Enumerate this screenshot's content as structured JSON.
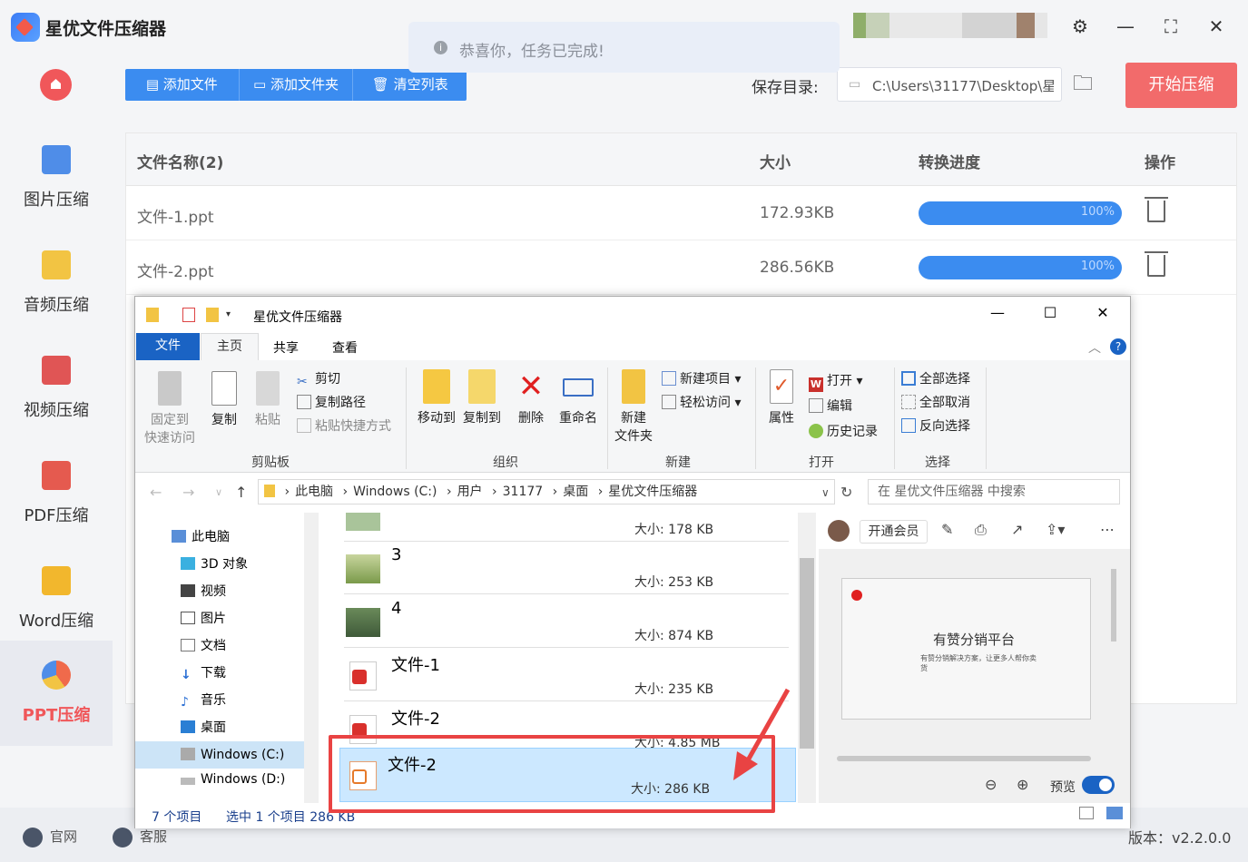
{
  "app": {
    "title": "星优文件压缩器",
    "toast": "恭喜你，任务已完成!",
    "version": "版本：v2.2.0.0"
  },
  "sidebar": {
    "items": [
      {
        "label": "图片压缩",
        "color": "#4f8de8"
      },
      {
        "label": "音频压缩",
        "color": "#f2c443"
      },
      {
        "label": "视频压缩",
        "color": "#e05555"
      },
      {
        "label": "PDF压缩",
        "color": "#e55a4f"
      },
      {
        "label": "Word压缩",
        "color": "#f2b72d"
      },
      {
        "label": "PPT压缩",
        "color": "#f06a4b"
      }
    ]
  },
  "toolbar": {
    "add_file": "添加文件",
    "add_folder": "添加文件夹",
    "clear_list": "清空列表",
    "save_label": "保存目录:",
    "save_path": "C:\\Users\\31177\\Desktop\\星",
    "start": "开始压缩"
  },
  "table": {
    "headers": [
      "文件名称(2)",
      "大小",
      "转换进度",
      "操作"
    ],
    "rows": [
      {
        "name": "文件-1.ppt",
        "size": "172.93KB",
        "progress": "100%",
        "progress_value": 100
      },
      {
        "name": "文件-2.ppt",
        "size": "286.56KB",
        "progress": "100%",
        "progress_value": 100
      }
    ]
  },
  "bottom": {
    "website": "官网",
    "service": "客服"
  },
  "explorer": {
    "title": "星优文件压缩器",
    "tabs": [
      "文件",
      "主页",
      "共享",
      "查看"
    ],
    "ribbon": {
      "clipboard": {
        "pin": "固定到\n快速访问",
        "copy": "复制",
        "paste": "粘贴",
        "cut": "剪切",
        "copy_path": "复制路径",
        "paste_shortcut": "粘贴快捷方式",
        "label": "剪贴板"
      },
      "organize": {
        "move_to": "移动到",
        "copy_to": "复制到",
        "delete": "删除",
        "rename": "重命名",
        "label": "组织"
      },
      "new": {
        "new_folder": "新建\n文件夹",
        "new_item": "新建项目",
        "easy_access": "轻松访问",
        "label": "新建"
      },
      "open": {
        "properties": "属性",
        "open": "打开",
        "edit": "编辑",
        "history": "历史记录",
        "label": "打开"
      },
      "select": {
        "select_all": "全部选择",
        "select_none": "全部取消",
        "invert": "反向选择",
        "label": "选择"
      }
    },
    "address": [
      "此电脑",
      "Windows (C:)",
      "用户",
      "31177",
      "桌面",
      "星优文件压缩器"
    ],
    "search_placeholder": "在 星优文件压缩器 中搜索",
    "tree": [
      "此电脑",
      "3D 对象",
      "视频",
      "图片",
      "文档",
      "下载",
      "音乐",
      "桌面",
      "Windows (C:)",
      "Windows (D:)"
    ],
    "files": [
      {
        "name": "",
        "size": "大小: 178 KB"
      },
      {
        "name": "3",
        "size": "大小: 253 KB"
      },
      {
        "name": "4",
        "size": "大小: 874 KB"
      },
      {
        "name": "文件-1",
        "size": "大小: 235 KB"
      },
      {
        "name": "文件-2",
        "size": "大小: 4.85 MB"
      },
      {
        "name": "文件-2",
        "size": "大小: 286 KB"
      }
    ],
    "preview": {
      "vip": "开通会员",
      "slide_title": "有赞分销平台",
      "slide_sub": "有赞分销解决方案，让更多人帮你卖货",
      "toggle_label": "预览"
    },
    "status": {
      "count": "7 个项目",
      "selected": "选中 1 个项目  286 KB"
    }
  }
}
